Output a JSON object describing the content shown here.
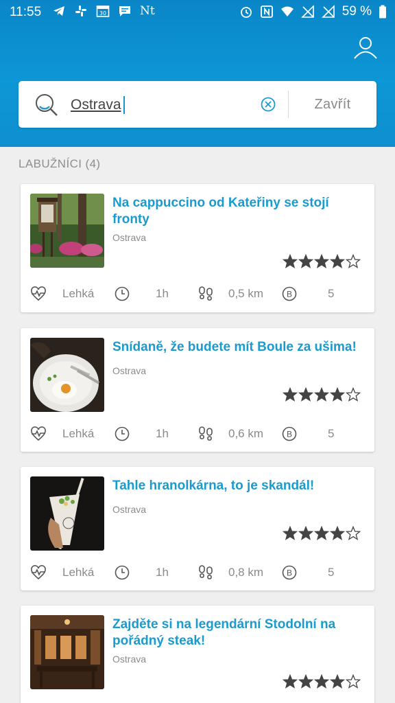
{
  "status_bar": {
    "time": "11:55",
    "nt": "Nt",
    "calendar_day": "30",
    "battery": "59 %",
    "left_icons": [
      "telegram-icon",
      "slack-icon",
      "calendar-icon",
      "message-icon"
    ],
    "right_icons": [
      "alarm-icon",
      "nfc-icon",
      "wifi-icon",
      "no-signal-icon",
      "no-signal-icon",
      "battery-icon"
    ]
  },
  "header": {
    "profile_icon": "user-icon",
    "accent_color": "#0d97d6"
  },
  "search": {
    "value": "Ostrava",
    "close_label": "Zavřít"
  },
  "section": {
    "title": "LABUŽNÍCI (4)"
  },
  "results": [
    {
      "title": "Na cappuccino od Kateřiny se stojí fronty",
      "city": "Ostrava",
      "rating": 4,
      "max_rating": 5,
      "difficulty": "Lehká",
      "duration": "1h",
      "distance": "0,5 km",
      "points": "5"
    },
    {
      "title": "Snídaně, že budete mít Boule za ušima!",
      "city": "Ostrava",
      "rating": 4,
      "max_rating": 5,
      "difficulty": "Lehká",
      "duration": "1h",
      "distance": "0,6 km",
      "points": "5"
    },
    {
      "title": "Tahle hranolkárna, to je skandál!",
      "city": "Ostrava",
      "rating": 4,
      "max_rating": 5,
      "difficulty": "Lehká",
      "duration": "1h",
      "distance": "0,8 km",
      "points": "5"
    },
    {
      "title": "Zajděte si na legendární Stodolní na pořádný steak!",
      "city": "Ostrava",
      "rating": 4,
      "max_rating": 5
    }
  ]
}
